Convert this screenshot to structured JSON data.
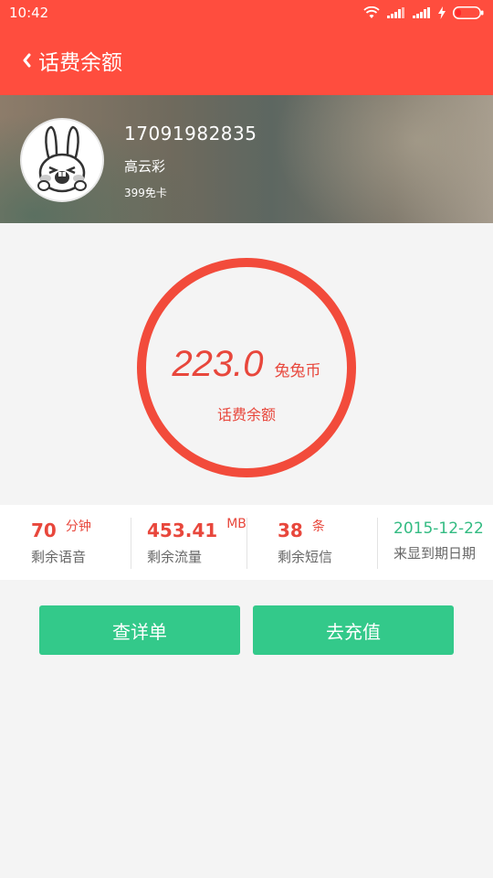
{
  "status_bar": {
    "time": "10:42"
  },
  "app_bar": {
    "title": "话费余额"
  },
  "profile": {
    "phone": "17091982835",
    "name": "高云彩",
    "plan": "399免卡"
  },
  "balance": {
    "value": "223.0",
    "unit": "兔兔币",
    "label": "话费余额"
  },
  "stats": [
    {
      "value": "70",
      "unit": "分钟",
      "label": "剩余语音"
    },
    {
      "value": "453.41",
      "unit": "MB",
      "label": "剩余流量"
    },
    {
      "value": "38",
      "unit": "条",
      "label": "剩余短信"
    },
    {
      "value": "2015-12-22",
      "label": "来显到期日期"
    }
  ],
  "buttons": {
    "details": "查详单",
    "recharge": "去充值"
  },
  "colors": {
    "primary": "#ff4d3e",
    "accent_text": "#e8473c",
    "button": "#33c98a",
    "date": "#33bb82"
  }
}
